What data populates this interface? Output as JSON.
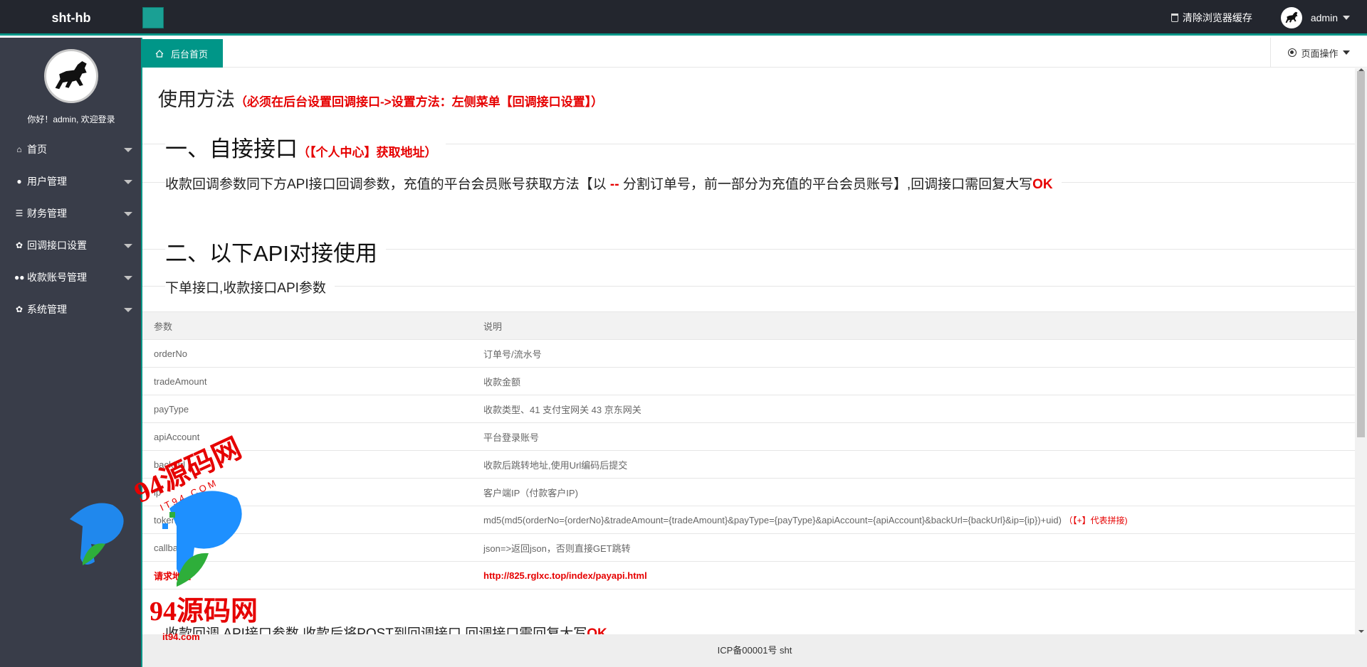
{
  "header": {
    "brand": "sht-hb",
    "clear_cache_label": "清除浏览器缓存",
    "username": "admin"
  },
  "sidebar": {
    "welcome": "你好！admin, 欢迎登录",
    "items": [
      {
        "label": "首页",
        "icon": "home-icon"
      },
      {
        "label": "用户管理",
        "icon": "user-icon"
      },
      {
        "label": "财务管理",
        "icon": "list-icon"
      },
      {
        "label": "回调接口设置",
        "icon": "gear-icon"
      },
      {
        "label": "收款账号管理",
        "icon": "users-icon"
      },
      {
        "label": "系统管理",
        "icon": "gear-icon"
      }
    ]
  },
  "tabs": {
    "active_label": "后台首页",
    "page_ops_label": "页面操作"
  },
  "content": {
    "usage_title": "使用方法",
    "usage_note": "（必须在后台设置回调接口->设置方法：左侧菜单【回调接口设置】）",
    "section1_title": "一、自接接口",
    "section1_note": "（【个人中心】获取地址）",
    "section1_para_a": "收款回调参数同下方API接口回调参数，充值的平台会员账号获取方法【以 ",
    "section1_para_sep": "--",
    "section1_para_b": " 分割订单号，前一部分为充值的平台会员账号】,回调接口需回复大写",
    "section1_para_ok": "OK",
    "section2_title": "二、以下API对接使用",
    "section2_sub": "下单接口,收款接口API参数",
    "table": {
      "headers": [
        "参数",
        "说明"
      ],
      "rows": [
        {
          "param": "orderNo",
          "desc": "订单号/流水号"
        },
        {
          "param": "tradeAmount",
          "desc": "收款金额"
        },
        {
          "param": "payType",
          "desc": "收款类型、41 支付宝网关 43 京东网关"
        },
        {
          "param": "apiAccount",
          "desc": "平台登录账号"
        },
        {
          "param": "backUrl",
          "desc": "收款后跳转地址,使用Url编码后提交"
        },
        {
          "param": "ip",
          "desc": "客户端IP（付款客户IP)"
        },
        {
          "param": "token",
          "desc": "md5(md5(orderNo={orderNo}&tradeAmount={tradeAmount}&payType={payType}&apiAccount={apiAccount}&backUrl={backUrl}&ip={ip})+uid)",
          "note": "（【+】代表拼接)"
        },
        {
          "param": "callback",
          "desc": "json=>返回json，否则直接GET跳转"
        }
      ],
      "request": {
        "param": "请求地址",
        "desc": "http://825.rglxc.top/index/payapi.html"
      }
    },
    "bottom_cut": "收款回调 API接口参数 收款后将POST到回调接口 回调接口需回复大写",
    "bottom_cut_ok": "OK"
  },
  "footer": {
    "text": "ICP备00001号 sht"
  },
  "watermark": {
    "brand_text": "94源码网",
    "domain_spaced": "I T 9 4 . C O M",
    "url_text": "it94.com"
  },
  "colors": {
    "topbar": "#23262e",
    "sidebar": "#393d49",
    "accent": "#009688",
    "highlight": "#e60000"
  }
}
